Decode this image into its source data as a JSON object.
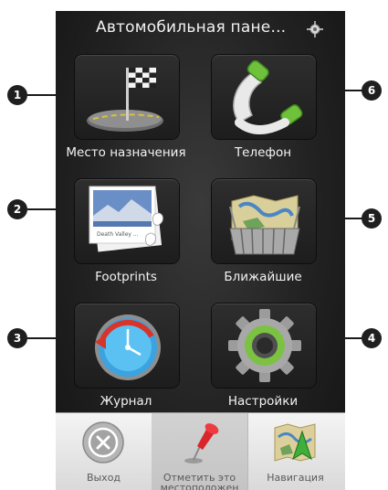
{
  "screen": {
    "title": "Автомобильная пане..."
  },
  "tiles": [
    {
      "label": "Место назначения",
      "icon": "checkered-flag-icon"
    },
    {
      "label": "Телефон",
      "icon": "phone-handset-icon"
    },
    {
      "label": "Footprints",
      "icon": "footprints-photo-icon"
    },
    {
      "label": "Ближайшие",
      "icon": "nearby-map-icon"
    },
    {
      "label": "Журнал",
      "icon": "clock-history-icon"
    },
    {
      "label": "Настройки",
      "icon": "gear-settings-icon"
    }
  ],
  "dock": [
    {
      "label": "Выход",
      "icon": "exit-icon"
    },
    {
      "label": "Отметить это местоположен",
      "icon": "pushpin-icon"
    },
    {
      "label": "Навигация",
      "icon": "navigation-map-icon"
    }
  ],
  "callouts": [
    "1",
    "2",
    "3",
    "4",
    "5",
    "6"
  ],
  "colors": {
    "panel_bg": "#222222",
    "label_text": "#f3f3f3",
    "dock_bg": "#e6e6e6",
    "callout_bg": "#1f1f1f"
  }
}
